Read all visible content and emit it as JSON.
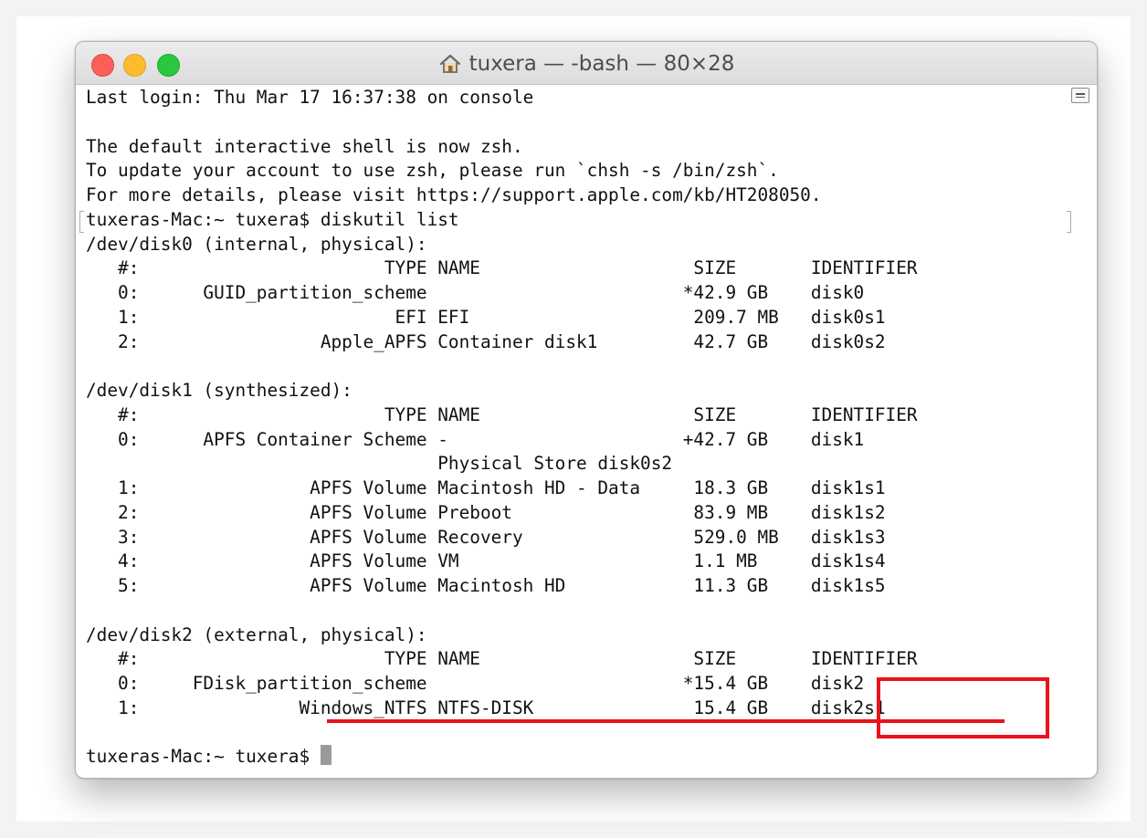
{
  "window": {
    "title": "tuxera — -bash — 80×28",
    "title_icon": "home-icon",
    "controls": [
      "close-button",
      "minimize-button",
      "zoom-button"
    ]
  },
  "terminal": {
    "lines": [
      "Last login: Thu Mar 17 16:37:38 on console",
      "",
      "The default interactive shell is now zsh.",
      "To update your account to use zsh, please run `chsh -s /bin/zsh`.",
      "For more details, please visit https://support.apple.com/kb/HT208050.",
      "tuxeras-Mac:~ tuxera$ diskutil list",
      "/dev/disk0 (internal, physical):",
      "   #:                       TYPE NAME                    SIZE       IDENTIFIER",
      "   0:      GUID_partition_scheme                        *42.9 GB    disk0",
      "   1:                        EFI EFI                     209.7 MB   disk0s1",
      "   2:                 Apple_APFS Container disk1         42.7 GB    disk0s2",
      "",
      "/dev/disk1 (synthesized):",
      "   #:                       TYPE NAME                    SIZE       IDENTIFIER",
      "   0:      APFS Container Scheme -                      +42.7 GB    disk1",
      "                                 Physical Store disk0s2",
      "   1:                APFS Volume Macintosh HD - Data     18.3 GB    disk1s1",
      "   2:                APFS Volume Preboot                 83.9 MB    disk1s2",
      "   3:                APFS Volume Recovery                529.0 MB   disk1s3",
      "   4:                APFS Volume VM                      1.1 MB     disk1s4",
      "   5:                APFS Volume Macintosh HD            11.3 GB    disk1s5",
      "",
      "/dev/disk2 (external, physical):",
      "   #:                       TYPE NAME                    SIZE       IDENTIFIER",
      "   0:     FDisk_partition_scheme                        *15.4 GB    disk2",
      "   1:               Windows_NTFS NTFS-DISK               15.4 GB    disk2s1",
      ""
    ],
    "prompt": "tuxeras-Mac:~ tuxera$ "
  },
  "annotations": {
    "color": "#e8141c",
    "highlight": "Windows_NTFS NTFS-DISK               15.4 GB    disk2s1",
    "boxed_identifier": "disk2s1"
  }
}
